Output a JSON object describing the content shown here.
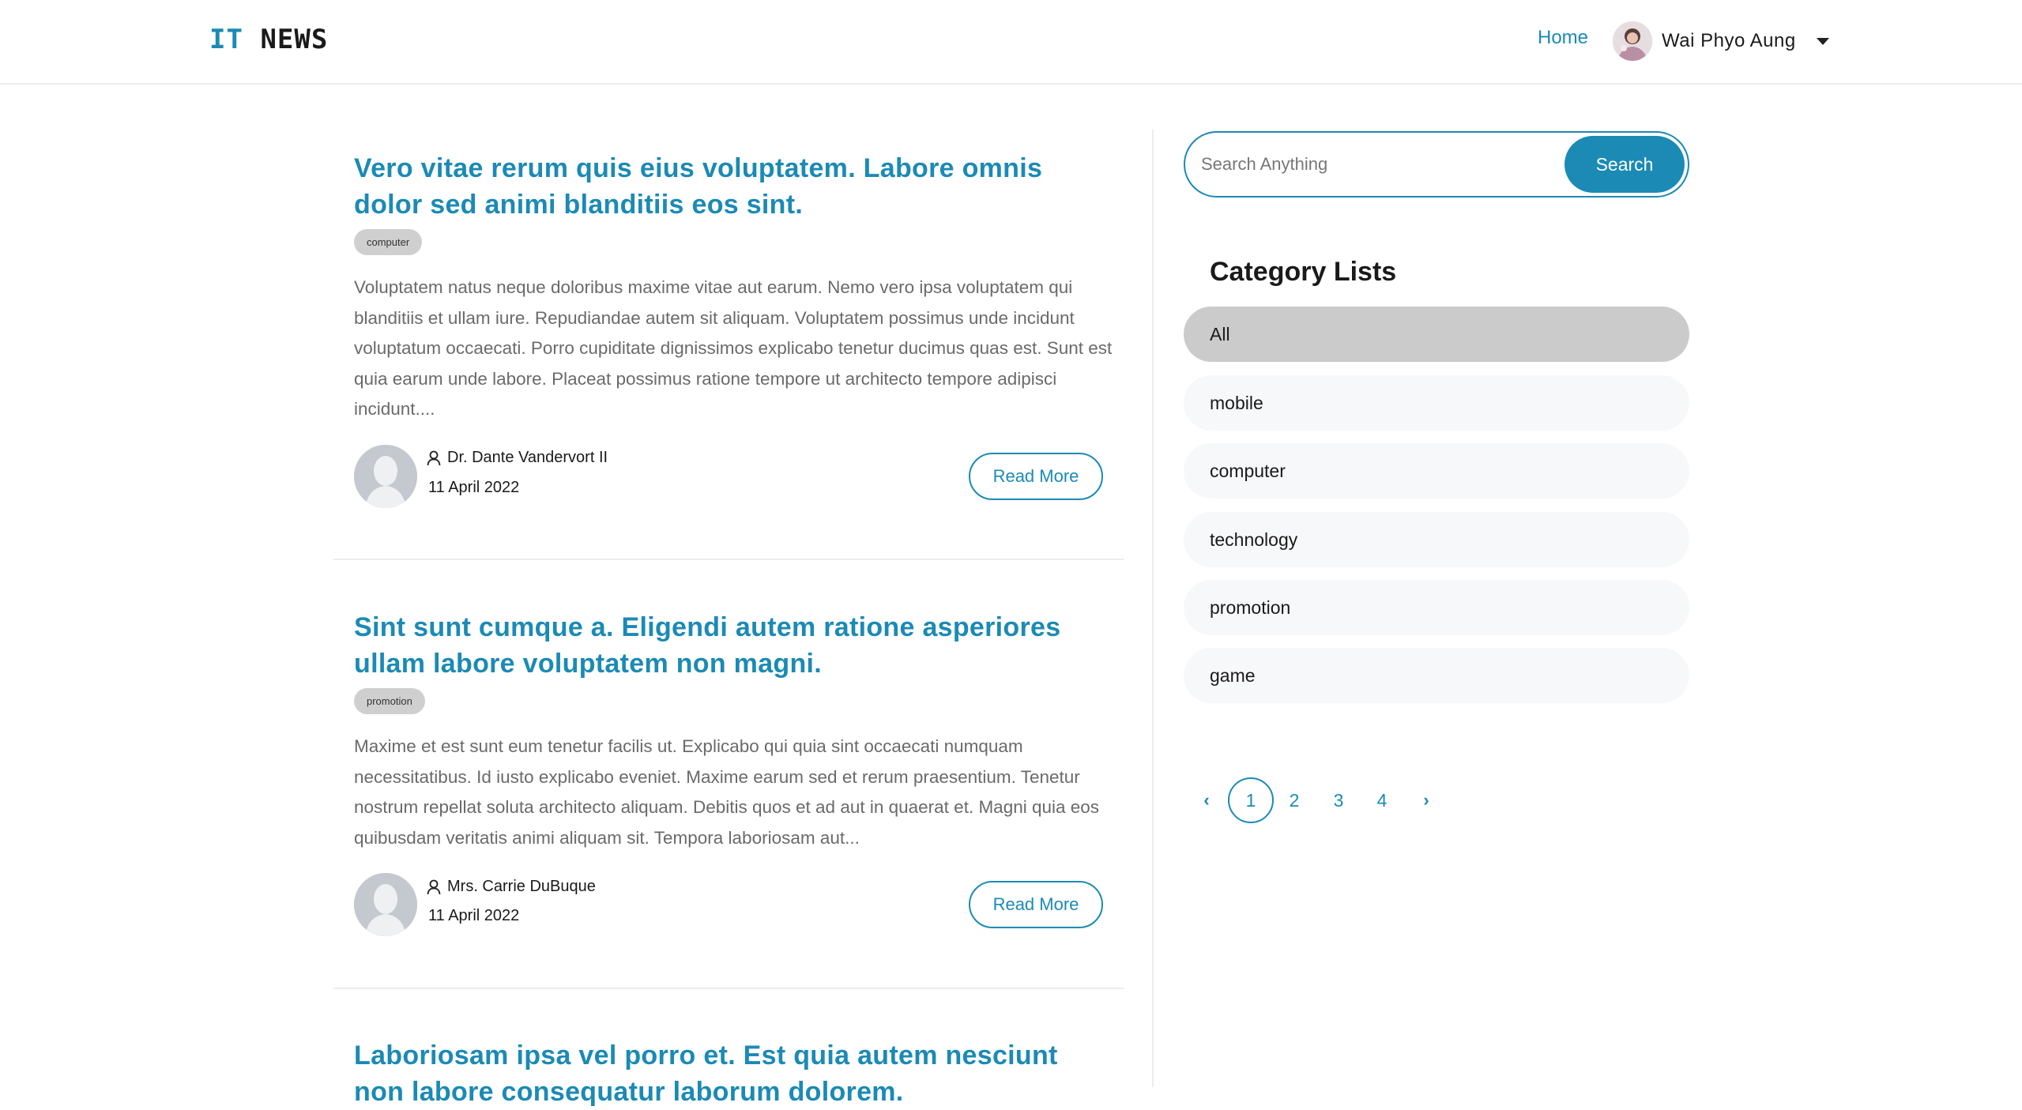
{
  "navbar": {
    "brand_part1": "IT",
    "brand_part2": "NEWS",
    "home_label": "Home",
    "user_name": "Wai Phyo Aung"
  },
  "posts": [
    {
      "title": "Vero vitae rerum quis eius voluptatem. Labore omnis dolor sed animi blanditiis eos sint.",
      "category": "computer",
      "excerpt": "Voluptatem natus neque doloribus maxime vitae aut earum. Nemo vero ipsa voluptatem qui blanditiis et ullam iure. Repudiandae autem sit aliquam. Voluptatem possimus unde incidunt voluptatum occaecati. Porro cupiditate dignissimos explicabo tenetur ducimus quas est. Sunt est quia earum unde labore. Placeat possimus ratione tempore ut architecto tempore adipisci incidunt....",
      "author": "Dr. Dante Vandervort II",
      "date": "11 April 2022",
      "read_more_label": "Read More"
    },
    {
      "title": "Sint sunt cumque a. Eligendi autem ratione asperiores ullam labore voluptatem non magni.",
      "category": "promotion",
      "excerpt": "Maxime et est sunt eum tenetur facilis ut. Explicabo qui quia sint occaecati numquam necessitatibus. Id iusto explicabo eveniet. Maxime earum sed et rerum praesentium. Tenetur nostrum repellat soluta architecto aliquam. Debitis quos et ad aut in quaerat et. Magni quia eos quibusdam veritatis animi aliquam sit. Tempora laboriosam aut...",
      "author": "Mrs. Carrie DuBuque",
      "date": "11 April 2022",
      "read_more_label": "Read More"
    },
    {
      "title": "Laboriosam ipsa vel porro et. Est quia autem nesciunt non labore consequatur laborum dolorem."
    }
  ],
  "search": {
    "placeholder": "Search Anything",
    "button_label": "Search"
  },
  "categories": {
    "title": "Category Lists",
    "items": [
      "All",
      "mobile",
      "computer",
      "technology",
      "promotion",
      "game"
    ],
    "active_index": 0
  },
  "pagination": {
    "prev": "‹",
    "pages": [
      "1",
      "2",
      "3",
      "4"
    ],
    "current": "1",
    "next": "›"
  },
  "colors": {
    "accent": "#1b8ab5",
    "active_category_bg": "#cbcbcb",
    "category_bg": "#f7f8fa"
  },
  "icons": {
    "author": "user-icon",
    "author_avatar": "default-avatar-icon",
    "menu_toggle": "caret-down-icon"
  }
}
